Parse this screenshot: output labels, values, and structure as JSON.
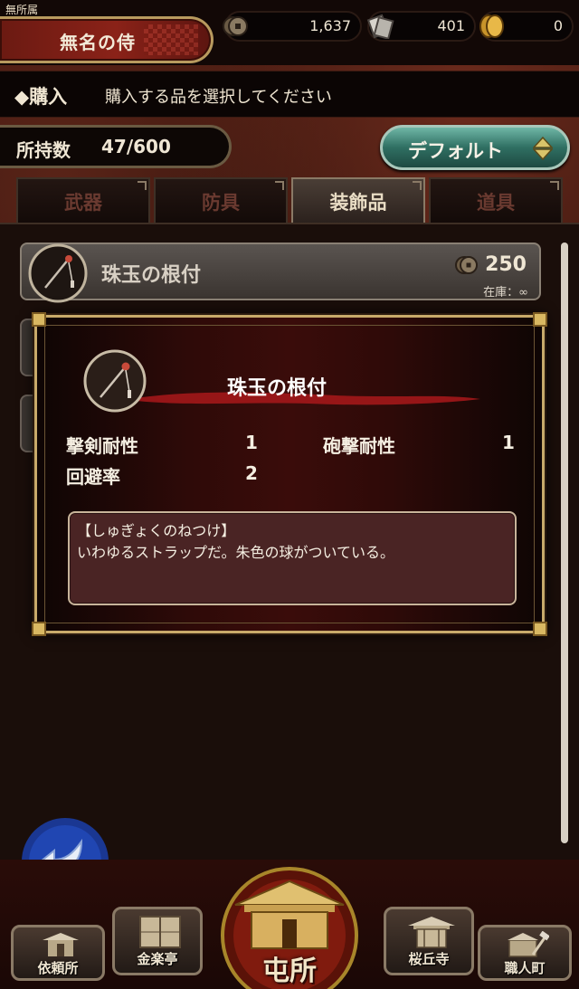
{
  "status": {
    "affiliation": "無所属",
    "player_name": "無名の侍"
  },
  "resources": [
    {
      "icon": "coin-icon",
      "value": "1,637"
    },
    {
      "icon": "token-card-icon",
      "value": "401"
    },
    {
      "icon": "gold-koban-icon",
      "value": "0"
    }
  ],
  "purchase": {
    "title": "◆購入",
    "message": "購入する品を選択してください"
  },
  "inventory": {
    "label": "所持数",
    "value": "47/600"
  },
  "sort_button": {
    "label": "デフォルト"
  },
  "tabs": [
    {
      "label": "武器",
      "active": false
    },
    {
      "label": "防具",
      "active": false
    },
    {
      "label": "装飾品",
      "active": true
    },
    {
      "label": "道具",
      "active": false
    }
  ],
  "item": {
    "name": "珠玉の根付",
    "price": "250",
    "stock": "在庫：∞"
  },
  "detail": {
    "title": "珠玉の根付",
    "stats": [
      {
        "label": "撃剣耐性",
        "value": "1"
      },
      {
        "label": "砲撃耐性",
        "value": "1"
      },
      {
        "label": "回避率",
        "value": "2"
      }
    ],
    "description_reading": "【しゅぎょくのねつけ】",
    "description": "いわゆるストラップだ。朱色の球がついている。"
  },
  "nav": [
    {
      "label": "依頼所"
    },
    {
      "label": "金楽亭"
    },
    {
      "label": "屯所"
    },
    {
      "label": "桜丘寺"
    },
    {
      "label": "職人町"
    }
  ],
  "colors": {
    "accent_red": "#8a2218",
    "frame_gold": "#c8aa6a",
    "sort_button_teal": "#2f6f62"
  }
}
